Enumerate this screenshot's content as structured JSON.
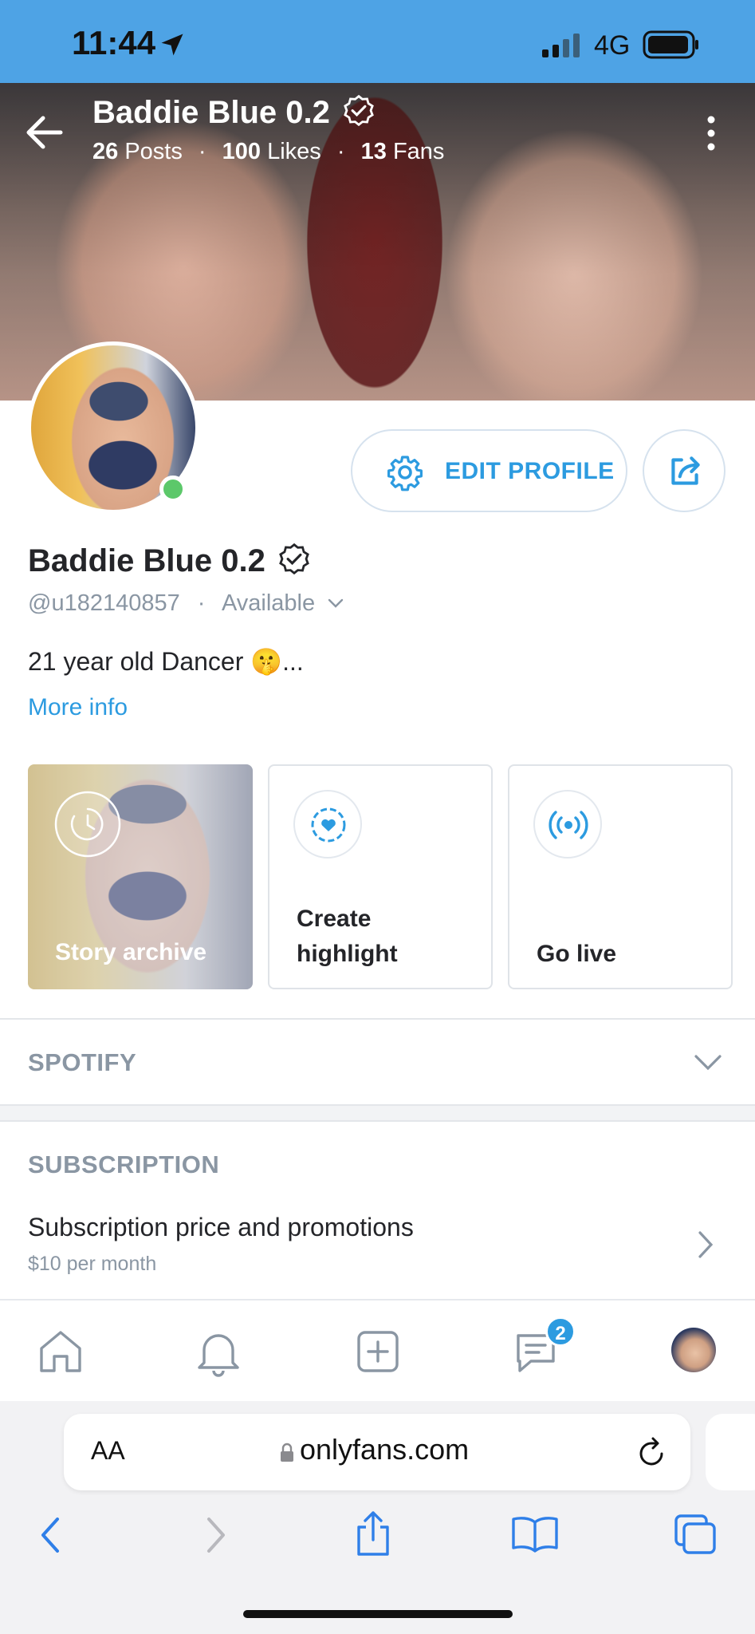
{
  "status_bar": {
    "time": "11:44",
    "network": "4G"
  },
  "header": {
    "title": "Baddie Blue 0.2",
    "posts": "26",
    "posts_label": "Posts",
    "likes": "100",
    "likes_label": "Likes",
    "fans": "13",
    "fans_label": "Fans"
  },
  "profile": {
    "edit_label": "EDIT PROFILE",
    "name": "Baddie Blue 0.2",
    "handle": "@u182140857",
    "availability": "Available",
    "bio": "21 year old Dancer 🤫...",
    "more_info": "More info"
  },
  "highlights": {
    "archive_label": "Story archive",
    "create_line1": "Create",
    "create_line2": "highlight",
    "live_label": "Go live"
  },
  "sections": {
    "spotify": "SPOTIFY",
    "subscription": "SUBSCRIPTION",
    "sub_row_title": "Subscription price and promotions",
    "sub_row_price": "$10 per month"
  },
  "nav": {
    "messages_badge": "2"
  },
  "browser": {
    "text_size": "AA",
    "url": "onlyfans.com"
  },
  "colors": {
    "accent": "#2c9be0",
    "status_bar": "#4ea3e5",
    "online": "#5cc86a"
  }
}
